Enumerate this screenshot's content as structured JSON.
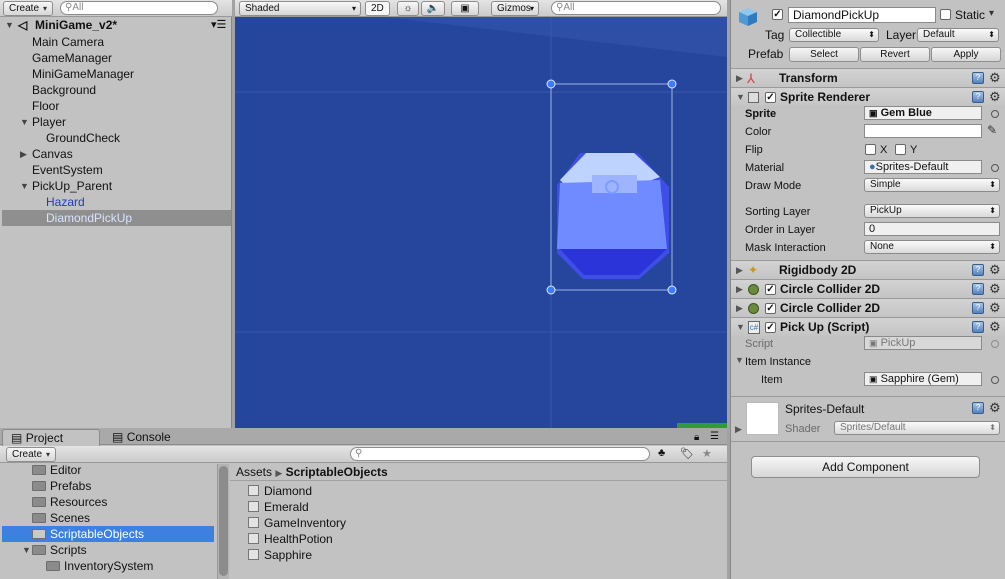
{
  "hierarchy": {
    "create_label": "Create",
    "search_placeholder": "All",
    "scene_name": "MiniGame_v2*",
    "items": [
      {
        "label": "Main Camera"
      },
      {
        "label": "GameManager"
      },
      {
        "label": "MiniGameManager"
      },
      {
        "label": "Background"
      },
      {
        "label": "Floor"
      },
      {
        "label": "Player"
      },
      {
        "label": "GroundCheck"
      },
      {
        "label": "Canvas"
      },
      {
        "label": "EventSystem"
      },
      {
        "label": "PickUp_Parent"
      },
      {
        "label": "Hazard"
      },
      {
        "label": "DiamondPickUp"
      }
    ]
  },
  "scene_view": {
    "shading_mode": "Shaded",
    "mode_2d": "2D",
    "gizmos_label": "Gizmos",
    "search_placeholder": "All"
  },
  "inspector": {
    "object_name": "DiamondPickUp",
    "static_label": "Static",
    "tag_label": "Tag",
    "tag_value": "Collectible",
    "layer_label": "Layer",
    "layer_value": "Default",
    "prefab_label": "Prefab",
    "prefab_select": "Select",
    "prefab_revert": "Revert",
    "prefab_apply": "Apply",
    "transform_title": "Transform",
    "sprite_renderer": {
      "title": "Sprite Renderer",
      "sprite_label": "Sprite",
      "sprite_value": "Gem Blue",
      "color_label": "Color",
      "flip_label": "Flip",
      "flip_x": "X",
      "flip_y": "Y",
      "material_label": "Material",
      "material_value": "Sprites-Default",
      "draw_mode_label": "Draw Mode",
      "draw_mode_value": "Simple",
      "sorting_layer_label": "Sorting Layer",
      "sorting_layer_value": "PickUp",
      "order_label": "Order in Layer",
      "order_value": "0",
      "mask_label": "Mask Interaction",
      "mask_value": "None"
    },
    "rigidbody_title": "Rigidbody 2D",
    "circle_collider_1": "Circle Collider 2D",
    "circle_collider_2": "Circle Collider 2D",
    "pickup_script": {
      "title": "Pick Up (Script)",
      "script_label": "Script",
      "script_value": "PickUp",
      "item_instance_label": "Item Instance",
      "item_label": "Item",
      "item_value": "Sapphire (Gem)"
    },
    "material_preview": {
      "name": "Sprites-Default",
      "shader_label": "Shader",
      "shader_value": "Sprites/Default"
    },
    "add_component_label": "Add Component"
  },
  "project": {
    "tab_project": "Project",
    "tab_console": "Console",
    "create_label": "Create",
    "folders": [
      {
        "label": "Editor"
      },
      {
        "label": "Prefabs"
      },
      {
        "label": "Resources"
      },
      {
        "label": "Scenes"
      },
      {
        "label": "ScriptableObjects"
      },
      {
        "label": "Scripts"
      },
      {
        "label": "InventorySystem"
      }
    ],
    "breadcrumb_root": "Assets",
    "breadcrumb_current": "ScriptableObjects",
    "assets": [
      {
        "label": "Diamond"
      },
      {
        "label": "Emerald"
      },
      {
        "label": "GameInventory"
      },
      {
        "label": "HealthPotion"
      },
      {
        "label": "Sapphire"
      }
    ]
  },
  "colors": {
    "scene_background": "#26459c",
    "selection": "#3d80df",
    "hierarchy_selected_text": "#2b52c9"
  }
}
